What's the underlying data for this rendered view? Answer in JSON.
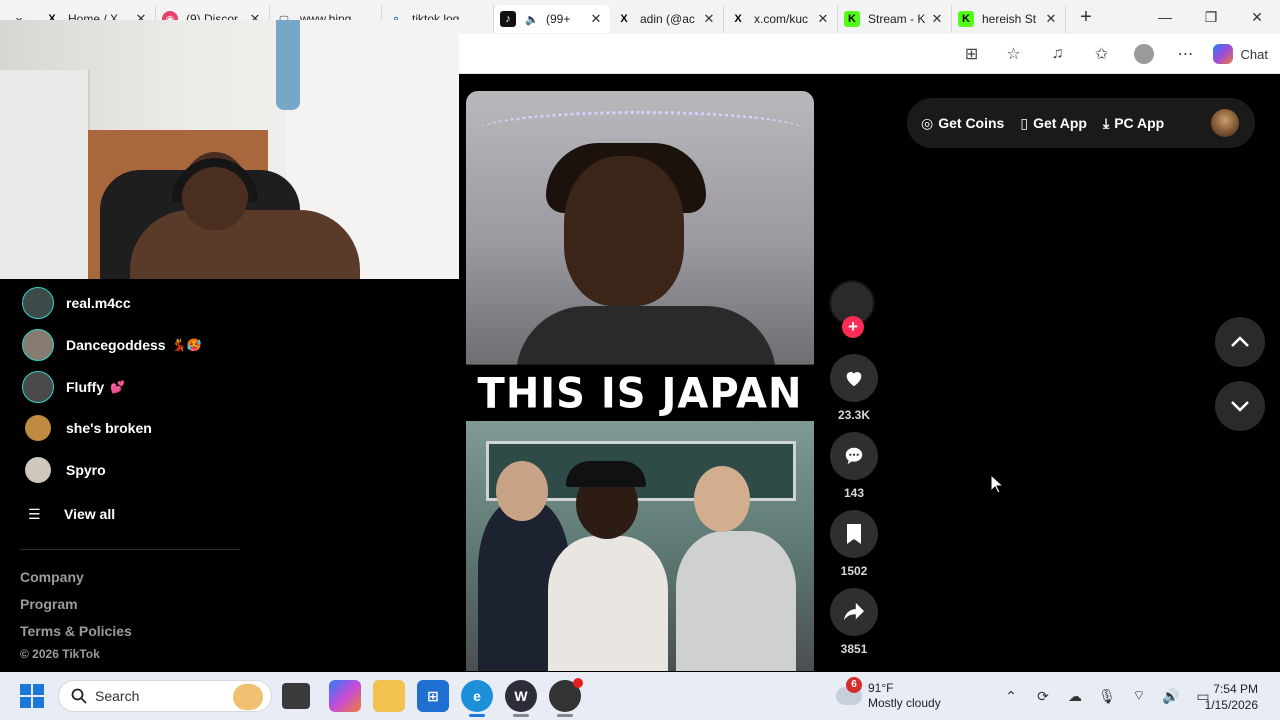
{
  "browser": {
    "tabs": [
      {
        "title": "",
        "favicon": "tab-dropdown"
      },
      {
        "title": "Home / X",
        "favicon": "x-logo"
      },
      {
        "title": "(9) Discor",
        "favicon": "discord-logo"
      },
      {
        "title": "www.bing",
        "favicon": "page-icon"
      },
      {
        "title": "tiktok log",
        "favicon": "search-icon"
      },
      {
        "title": "(99+",
        "favicon": "tiktok-logo"
      },
      {
        "title": "adin (@ac",
        "favicon": "x-logo"
      },
      {
        "title": "x.com/kuc",
        "favicon": "x-logo"
      },
      {
        "title": "Stream - K",
        "favicon": "kick-logo"
      },
      {
        "title": "hereish St",
        "favicon": "kick-logo"
      }
    ],
    "chat_label": "Chat"
  },
  "sidebar": {
    "following": [
      {
        "name": "real.m4cc",
        "emoji": ""
      },
      {
        "name": "Dancegoddess",
        "emoji": "💃🥵"
      },
      {
        "name": "Fluffy",
        "emoji": "💕"
      },
      {
        "name": "she's broken",
        "emoji": ""
      },
      {
        "name": "Spyro",
        "emoji": ""
      }
    ],
    "view_all": "View all",
    "footer_links": [
      "Company",
      "Program",
      "Terms & Policies"
    ],
    "copyright": "© 2026 TikTok"
  },
  "video": {
    "caption": "THIS IS JAPAN"
  },
  "actions": {
    "likes": "23.3K",
    "comments": "143",
    "saves": "1502",
    "shares": "3851"
  },
  "topbar": {
    "get_coins": "Get Coins",
    "get_app": "Get App",
    "pc_app": "PC App"
  },
  "taskbar": {
    "search_label": "Search",
    "weather_badge": "6",
    "temperature": "91°F",
    "condition": "Mostly cloudy",
    "time": "7:54 PM",
    "date": "1/15/2026"
  },
  "colors": {
    "accent_red": "#fe2c55",
    "ring_teal": "#2fd6c8",
    "background": "#000000"
  }
}
